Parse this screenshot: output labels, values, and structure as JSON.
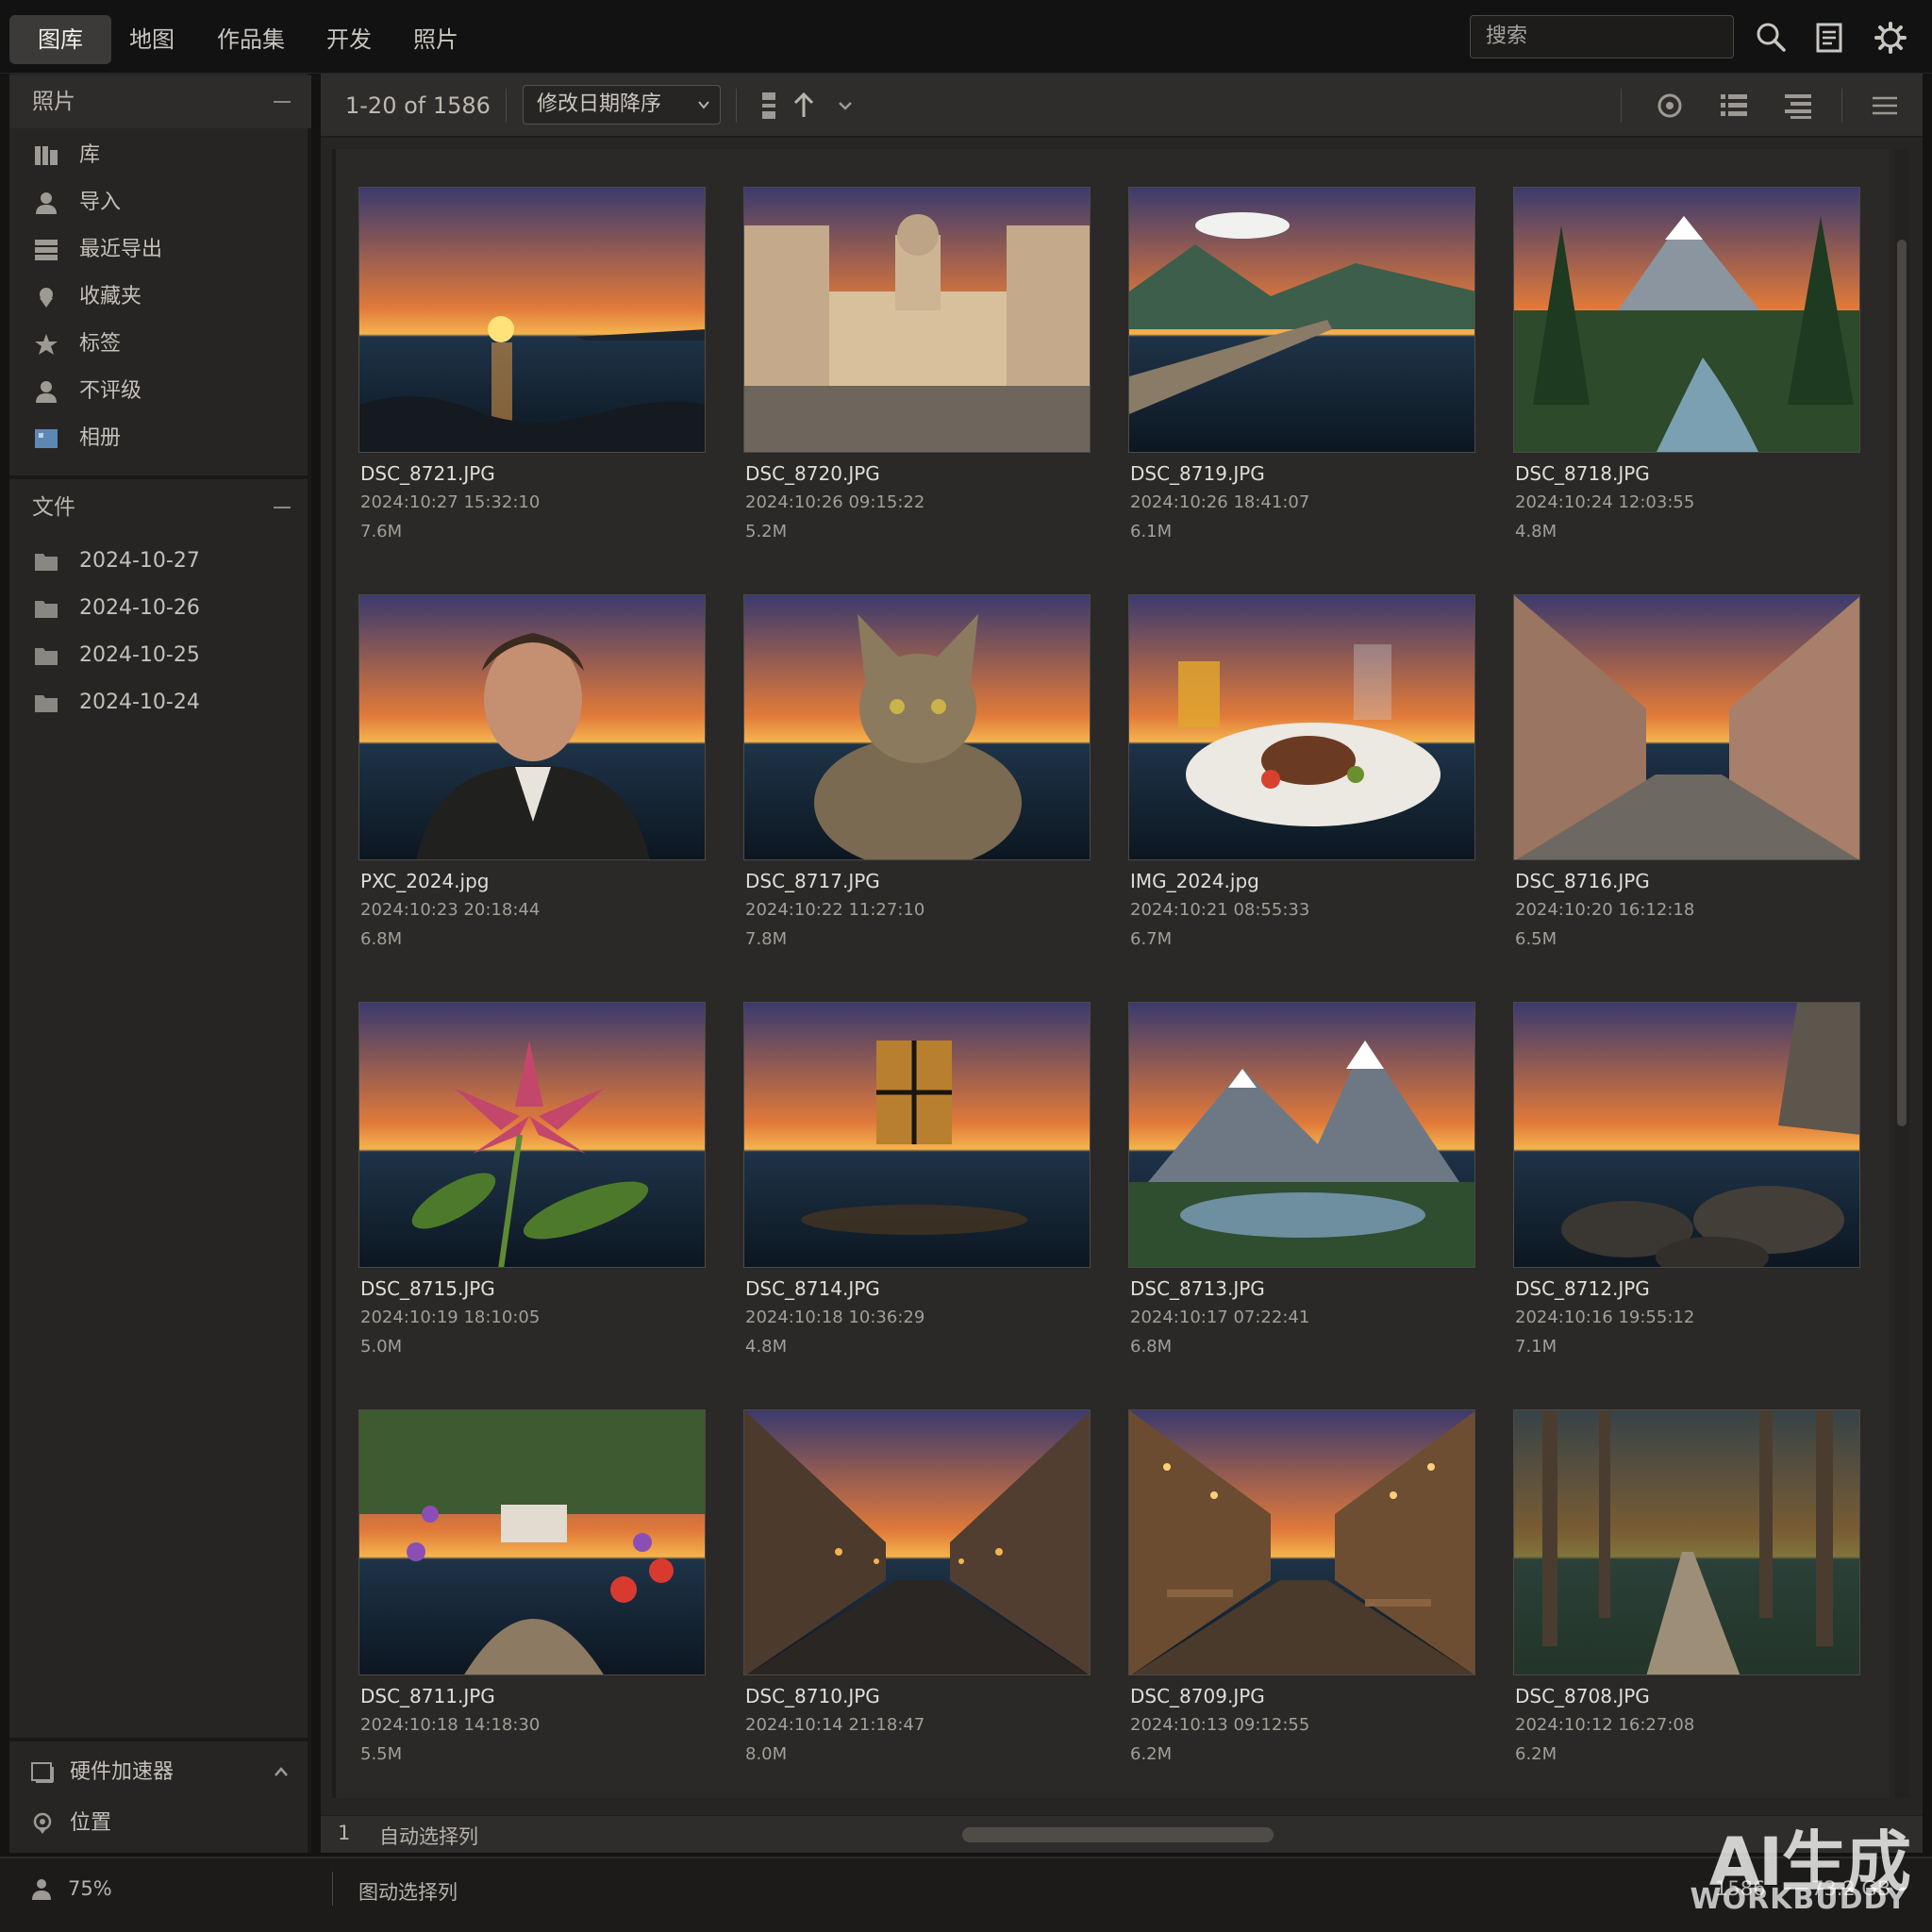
{
  "nav": {
    "tabs": [
      {
        "label": "图库",
        "active": true
      },
      {
        "label": "地图",
        "active": false
      },
      {
        "label": "作品集",
        "active": false
      },
      {
        "label": "开发",
        "active": false
      },
      {
        "label": "照片",
        "active": false
      }
    ],
    "search_placeholder": "搜索",
    "icons": [
      "search-icon",
      "document-icon",
      "settings-gear-icon"
    ]
  },
  "sidebar": {
    "photos_title": "照片",
    "photo_items": [
      {
        "label": "库",
        "icon": "library-icon"
      },
      {
        "label": "导入",
        "icon": "person-import-icon"
      },
      {
        "label": "最近导出",
        "icon": "stack-export-icon"
      },
      {
        "label": "收藏夹",
        "icon": "favorites-pin-icon"
      },
      {
        "label": "标签",
        "icon": "star-tag-icon"
      },
      {
        "label": "不评级",
        "icon": "person-unrated-icon"
      },
      {
        "label": "相册",
        "icon": "album-icon"
      }
    ],
    "files_title": "文件",
    "folders": [
      "2024-10-27",
      "2024-10-26",
      "2024-10-25",
      "2024-10-24"
    ],
    "bottom_items": [
      {
        "label": "硬件加速器",
        "icon": "hardware-accelerator-icon"
      },
      {
        "label": "位置",
        "icon": "location-pin-icon"
      }
    ]
  },
  "toolbar": {
    "count": "1-20 of 1586",
    "sort": "修改日期降序",
    "icons": [
      "group-icon",
      "sort-ascending-icon",
      "chevron-down-icon",
      "settings-circle-icon",
      "list-view-icon",
      "detail-list-icon",
      "menu-icon"
    ]
  },
  "photos": [
    {
      "name": "DSC_8721.JPG",
      "date": "2024:10:27 15:32:10",
      "size": "7.6M",
      "scene": "sunset-sea"
    },
    {
      "name": "DSC_8720.JPG",
      "date": "2024:10:26 09:15:22",
      "size": "5.2M",
      "scene": "palace-square"
    },
    {
      "name": "DSC_8719.JPG",
      "date": "2024:10:26 18:41:07",
      "size": "6.1M",
      "scene": "lake-pier"
    },
    {
      "name": "DSC_8718.JPG",
      "date": "2024:10:24 12:03:55",
      "size": "4.8M",
      "scene": "forest-mountain"
    },
    {
      "name": "PXC_2024.jpg",
      "date": "2024:10:23 20:18:44",
      "size": "6.8M",
      "scene": "portrait"
    },
    {
      "name": "DSC_8717.JPG",
      "date": "2024:10:22 11:27:10",
      "size": "7.8M",
      "scene": "cat"
    },
    {
      "name": "IMG_2024.jpg",
      "date": "2024:10:21 08:55:33",
      "size": "6.7M",
      "scene": "food-plate"
    },
    {
      "name": "DSC_8716.JPG",
      "date": "2024:10:20 16:12:18",
      "size": "6.5M",
      "scene": "old-street"
    },
    {
      "name": "DSC_8715.JPG",
      "date": "2024:10:19 18:10:05",
      "size": "5.0M",
      "scene": "pink-flower"
    },
    {
      "name": "DSC_8714.JPG",
      "date": "2024:10:18 10:36:29",
      "size": "4.8M",
      "scene": "dark-window"
    },
    {
      "name": "DSC_8713.JPG",
      "date": "2024:10:17 07:22:41",
      "size": "6.8M",
      "scene": "snowy-peaks"
    },
    {
      "name": "DSC_8712.JPG",
      "date": "2024:10:16 19:55:12",
      "size": "7.1M",
      "scene": "rocky-coast"
    },
    {
      "name": "DSC_8711.JPG",
      "date": "2024:10:18 14:18:30",
      "size": "5.5M",
      "scene": "garden-flowers"
    },
    {
      "name": "DSC_8710.JPG",
      "date": "2024:10:14 21:18:47",
      "size": "8.0M",
      "scene": "night-street"
    },
    {
      "name": "DSC_8709.JPG",
      "date": "2024:10:13 09:12:55",
      "size": "6.2M",
      "scene": "cafe-terrace"
    },
    {
      "name": "DSC_8708.JPG",
      "date": "2024:10:12 16:27:08",
      "size": "6.2M",
      "scene": "forest-path"
    }
  ],
  "grid_footer": {
    "page": "1",
    "label": "自动选择列"
  },
  "status": {
    "zoom": "75%",
    "label": "图动选择列",
    "count": "1586",
    "disk": "73.2 GB"
  },
  "watermark": {
    "line1": "AI生成",
    "line2": "WORKBUDDY"
  },
  "colors": {
    "background": "#141312",
    "panel": "#262523",
    "active_tab": "#3c3a38",
    "text": "#c9c6c1"
  }
}
